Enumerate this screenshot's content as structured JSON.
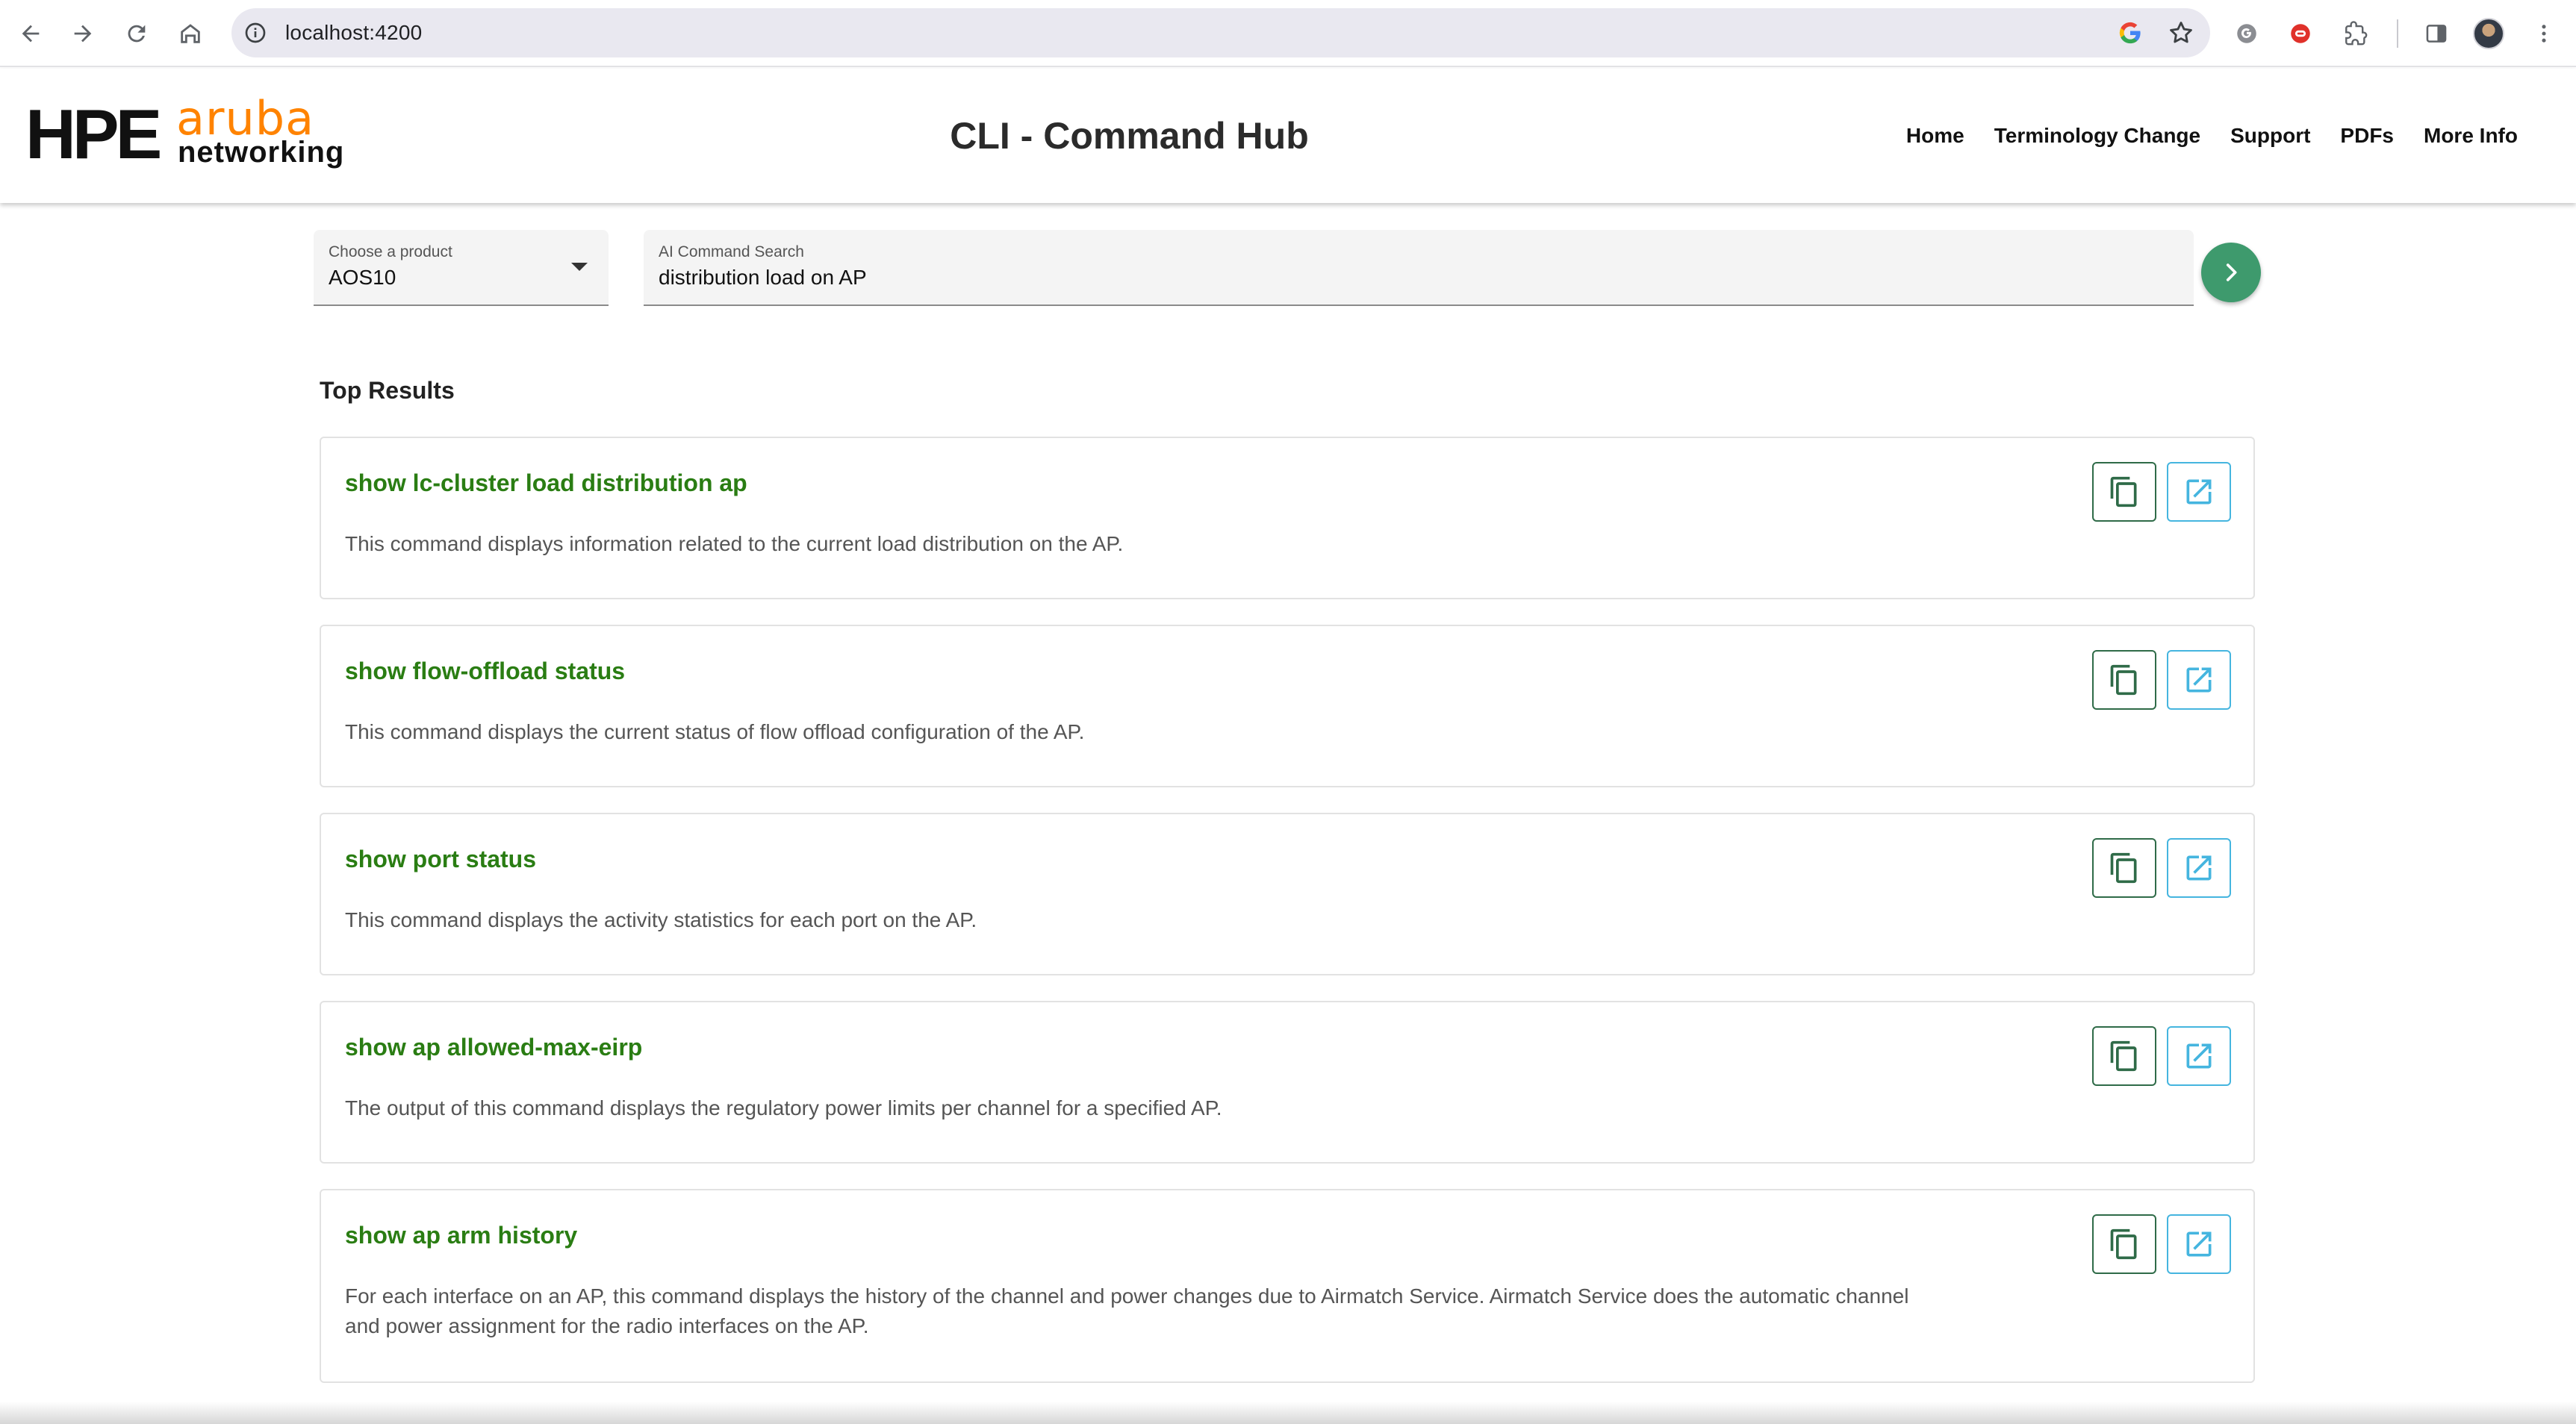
{
  "browser": {
    "url": "localhost:4200"
  },
  "header": {
    "logo": {
      "brand": "HPE",
      "product": "aruba",
      "sub": "networking"
    },
    "title": "CLI - Command Hub",
    "nav": [
      {
        "label": "Home"
      },
      {
        "label": "Terminology Change"
      },
      {
        "label": "Support"
      },
      {
        "label": "PDFs"
      },
      {
        "label": "More Info"
      }
    ]
  },
  "search": {
    "product_label": "Choose a product",
    "product_value": "AOS10",
    "query_label": "AI Command Search",
    "query_value": "distribution load on AP"
  },
  "results": {
    "heading": "Top Results",
    "items": [
      {
        "command": "show lc-cluster load distribution ap",
        "description": "This command displays information related to the current load distribution on the AP."
      },
      {
        "command": "show flow-offload status",
        "description": "This command displays the current status of flow offload configuration of the AP."
      },
      {
        "command": "show port status",
        "description": "This command displays the activity statistics for each port on the AP."
      },
      {
        "command": "show ap allowed-max-eirp",
        "description": "The output of this command displays the regulatory power limits per channel for a specified AP."
      },
      {
        "command": "show ap arm history",
        "description": "For each interface on an AP, this command displays the history of the channel and power changes due to Airmatch Service. Airmatch Service does the automatic channel and power assignment for the radio interfaces on the AP."
      }
    ]
  },
  "colors": {
    "command_green": "#2a7d13",
    "go_button": "#3e9a6d",
    "copy_border": "#2f6b48",
    "open_border": "#45b5df",
    "aruba_orange": "#ff8300"
  },
  "icons": {
    "go": "chevron-right-icon",
    "copy": "copy-icon",
    "open": "open-in-new-icon"
  }
}
